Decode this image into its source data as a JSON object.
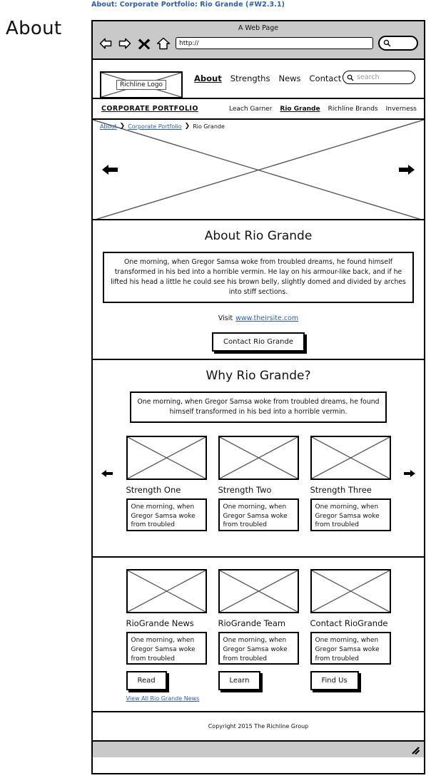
{
  "page": {
    "caption": "About: Corporate Portfolio: Rio Grande (#W2.3.1)",
    "side_title": "About",
    "link_color": "#2a5db0",
    "chrome_bg": "#c9c9c9"
  },
  "browser": {
    "title": "A Web Page",
    "url_value": "http://",
    "back_icon": "back-arrow-icon",
    "forward_icon": "forward-arrow-icon",
    "stop_icon": "close-x-icon",
    "home_icon": "home-icon",
    "search_icon": "search-icon"
  },
  "header": {
    "logo_label": "Richline Logo",
    "nav": [
      {
        "label": "About",
        "active": true
      },
      {
        "label": "Strengths",
        "active": false
      },
      {
        "label": "News",
        "active": false
      },
      {
        "label": "Contact",
        "active": false
      }
    ],
    "search_placeholder": "search"
  },
  "subnav": {
    "brand": "CORPORATE PORTFOLIO",
    "links": [
      {
        "label": "Leach Garner",
        "active": false
      },
      {
        "label": "Rio Grande",
        "active": true
      },
      {
        "label": "Richline Brands",
        "active": false
      },
      {
        "label": "Inverness",
        "active": false
      }
    ]
  },
  "hero": {
    "breadcrumb": [
      {
        "label": "About",
        "link": true
      },
      {
        "label": "Corporate Portfolio",
        "link": true
      },
      {
        "label": "Rio Grande",
        "link": false
      }
    ],
    "separator": "❯",
    "prev_icon": "carousel-prev-icon",
    "next_icon": "carousel-next-icon"
  },
  "about": {
    "title": "About Rio Grande",
    "body": "One morning, when Gregor Samsa woke from troubled dreams, he found himself transformed in his bed into a horrible vermin. He lay on his armour-like back, and if he lifted his head a little he could see his brown belly, slightly domed and divided by arches into stiff sections.",
    "visit_label": "Visit",
    "visit_link": "www.theirsite.com",
    "cta_label": "Contact Rio Grande"
  },
  "why": {
    "title": "Why Rio Grande?",
    "body": "One morning, when Gregor Samsa woke from troubled dreams, he found himself transformed in his bed into a horrible vermin.",
    "prev_icon": "strengths-prev-icon",
    "next_icon": "strengths-next-icon",
    "cards": [
      {
        "caption": "Strength One",
        "blurb": "One morning, when Gregor Samsa woke from troubled"
      },
      {
        "caption": "Strength Two",
        "blurb": "One morning, when Gregor Samsa woke from troubled"
      },
      {
        "caption": "Strength Three",
        "blurb": "One morning, when Gregor Samsa woke from troubled"
      }
    ]
  },
  "news": {
    "cards": [
      {
        "caption": "RioGrande News",
        "blurb": "One morning, when Gregor Samsa woke from troubled",
        "cta": "Read"
      },
      {
        "caption": "RioGrande Team",
        "blurb": "One morning, when Gregor Samsa woke from troubled",
        "cta": "Learn"
      },
      {
        "caption": "Contact RioGrande",
        "blurb": "One morning, when Gregor Samsa woke from troubled",
        "cta": "Find Us"
      }
    ],
    "view_all": "View All Rio Grande News"
  },
  "footer": {
    "copyright": "Copyright 2015 The Richline Group"
  }
}
